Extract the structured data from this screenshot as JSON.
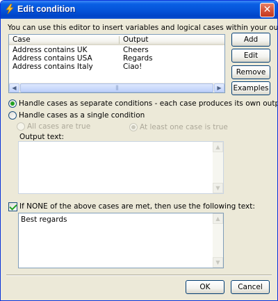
{
  "window": {
    "title": "Edit condition",
    "icon": "lightning-icon",
    "close_glyph": "✕"
  },
  "intro_text": "You can use this editor to insert variables and logical cases within your outgoing mail session",
  "cases_list": {
    "columns": [
      "Case",
      "Output"
    ],
    "rows": [
      {
        "case": "Address contains UK",
        "output": "Cheers"
      },
      {
        "case": "Address contains USA",
        "output": "Regards"
      },
      {
        "case": "Address contains Italy",
        "output": "Ciao!"
      }
    ],
    "scroll_left_glyph": "◀",
    "scroll_right_glyph": "▶",
    "thumb_grip": "|||"
  },
  "side_buttons": {
    "add": "Add",
    "edit": "Edit",
    "remove": "Remove",
    "examples": "Examples"
  },
  "mode": {
    "separate_label": "Handle cases as separate conditions - each case produces its own output",
    "single_label": "Handle cases as a single condition",
    "all_true_label": "All cases are true",
    "at_least_one_label": "At least one case is true",
    "selected": "separate"
  },
  "output_text": {
    "label": "Output text:",
    "value": "",
    "scroll_up_glyph": "▲",
    "scroll_down_glyph": "▼"
  },
  "fallback": {
    "checkbox_label": "If NONE of the above cases are met, then use the following text:",
    "checked": true,
    "value": "Best regards",
    "scroll_up_glyph": "▲",
    "scroll_down_glyph": "▼"
  },
  "footer": {
    "ok": "OK",
    "cancel": "Cancel"
  },
  "colors": {
    "titlebar": "#0553d8",
    "dialog_bg": "#ece9d8",
    "button_border": "#003c74",
    "check_green": "#21a121"
  }
}
